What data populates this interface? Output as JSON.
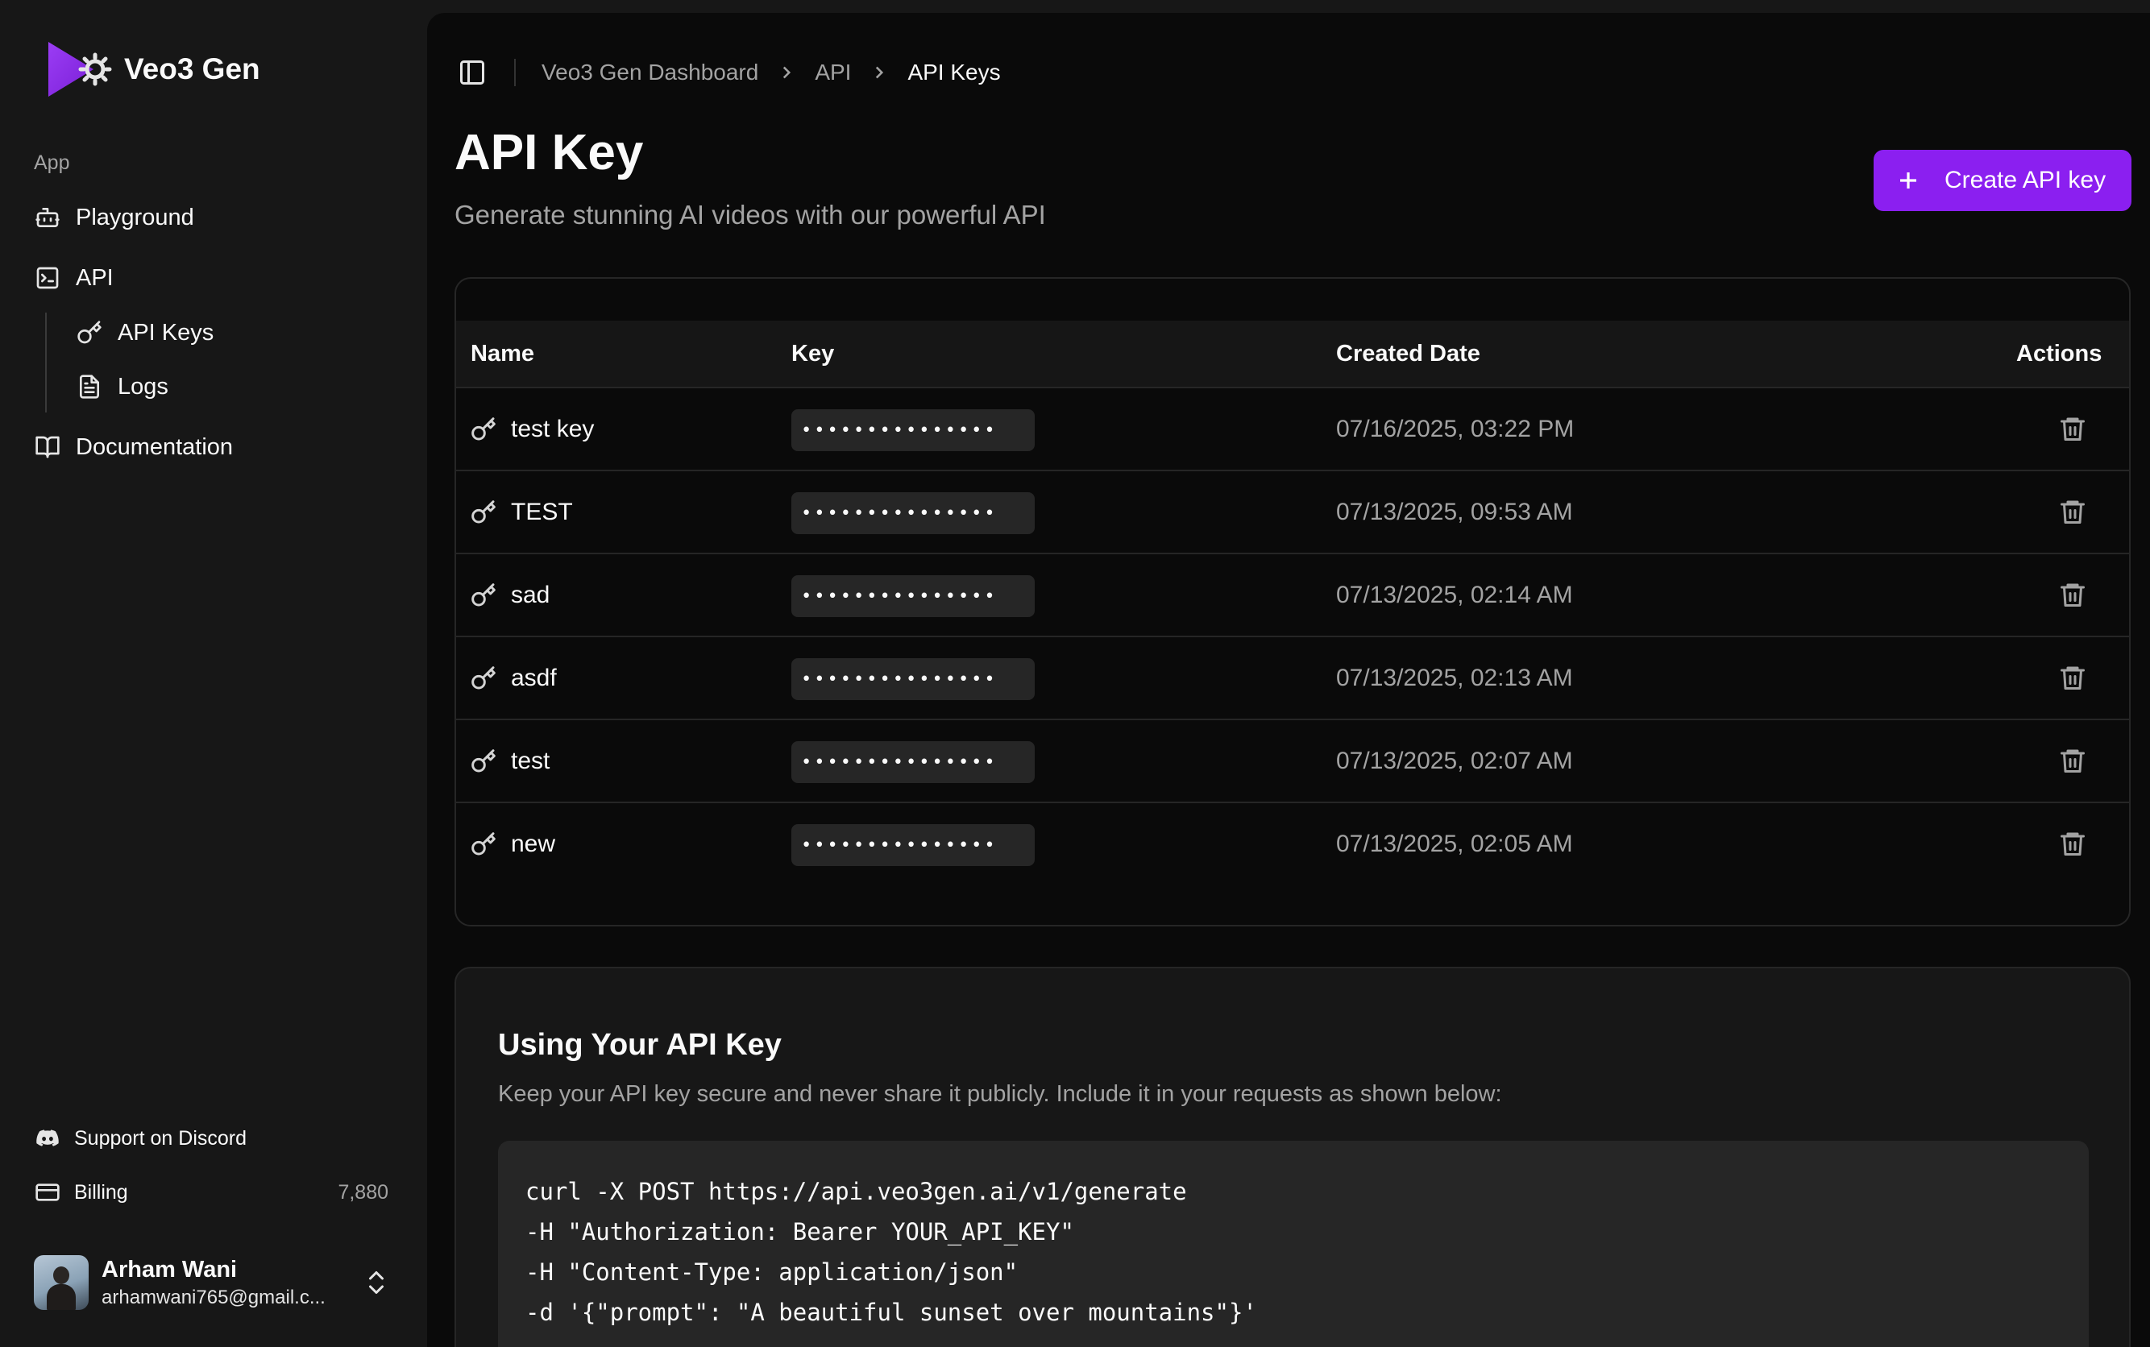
{
  "brand": {
    "name": "Veo3 Gen",
    "accent": "#8b1ff0"
  },
  "sidebar": {
    "group_label": "App",
    "items": [
      {
        "label": "Playground",
        "icon": "bot-icon"
      },
      {
        "label": "API",
        "icon": "terminal-square-icon"
      },
      {
        "label": "API Keys",
        "icon": "key-icon"
      },
      {
        "label": "Logs",
        "icon": "file-text-icon"
      },
      {
        "label": "Documentation",
        "icon": "book-open-icon"
      }
    ],
    "footer": {
      "discord": "Support on Discord",
      "billing": "Billing",
      "credits": "7,880"
    },
    "user": {
      "name": "Arham Wani",
      "email": "arhamwani765@gmail.c..."
    }
  },
  "breadcrumb": [
    "Veo3 Gen Dashboard",
    "API",
    "API Keys"
  ],
  "header": {
    "title": "API Key",
    "subtitle": "Generate stunning AI videos with our powerful API",
    "create_label": "Create API key"
  },
  "table": {
    "columns": [
      "Name",
      "Key",
      "Created Date",
      "Actions"
    ],
    "rows": [
      {
        "name": "test key",
        "key": "•••••••••••••••",
        "created": "07/16/2025, 03:22 PM"
      },
      {
        "name": "TEST",
        "key": "•••••••••••••••",
        "created": "07/13/2025, 09:53 AM"
      },
      {
        "name": "sad",
        "key": "•••••••••••••••",
        "created": "07/13/2025, 02:14 AM"
      },
      {
        "name": "asdf",
        "key": "•••••••••••••••",
        "created": "07/13/2025, 02:13 AM"
      },
      {
        "name": "test",
        "key": "•••••••••••••••",
        "created": "07/13/2025, 02:07 AM"
      },
      {
        "name": "new",
        "key": "•••••••••••••••",
        "created": "07/13/2025, 02:05 AM"
      }
    ]
  },
  "usage": {
    "title": "Using Your API Key",
    "description": "Keep your API key secure and never share it publicly. Include it in your requests as shown below:",
    "code": [
      "curl -X POST https://api.veo3gen.ai/v1/generate",
      "-H \"Authorization: Bearer YOUR_API_KEY\"",
      "-H \"Content-Type: application/json\"",
      "-d '{\"prompt\": \"A beautiful sunset over mountains\"}'"
    ]
  }
}
